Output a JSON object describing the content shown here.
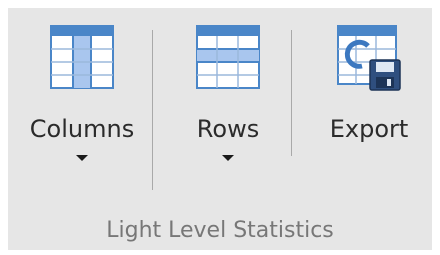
{
  "ribbon_group": {
    "label": "Light Level Statistics",
    "buttons": [
      {
        "label": "Columns",
        "icon": "columns-icon",
        "has_dropdown": true
      },
      {
        "label": "Rows",
        "icon": "rows-icon",
        "has_dropdown": true
      },
      {
        "label": "Export",
        "icon": "export-icon",
        "has_dropdown": false
      }
    ]
  },
  "colors": {
    "group_background": "#e6e6e6",
    "icon_blue": "#4a86c8",
    "icon_highlight": "#a9c6ee",
    "label_text": "#2b2b2b",
    "group_label_text": "#777777"
  }
}
